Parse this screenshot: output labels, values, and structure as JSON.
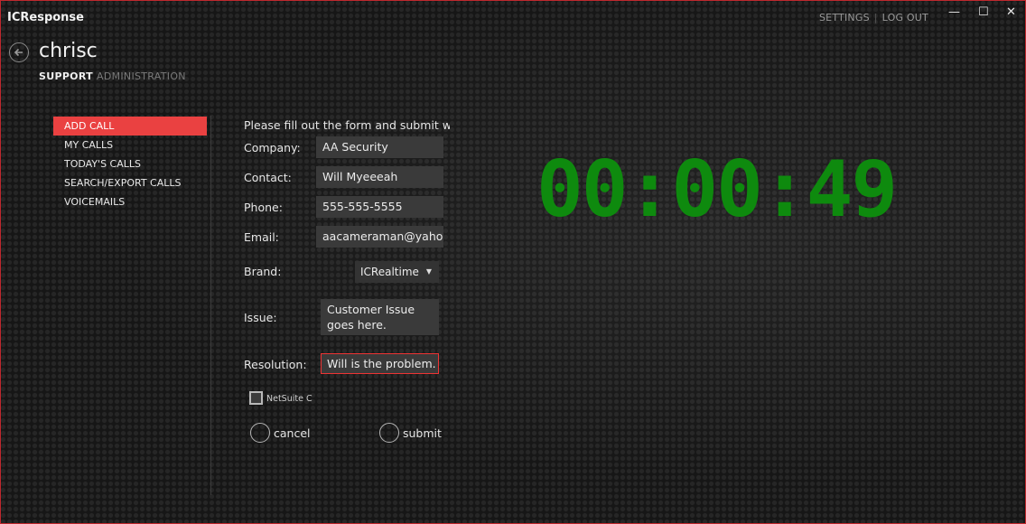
{
  "app": {
    "title": "ICResponse",
    "settings_label": "SETTINGS",
    "logout_label": "LOG OUT",
    "minimize": "—",
    "maximize": "☐",
    "close": "✕",
    "username": "chrisc"
  },
  "nav_tabs": [
    {
      "label": "SUPPORT",
      "active": true
    },
    {
      "label": "ADMINISTRATION",
      "active": false
    }
  ],
  "sidebar": {
    "items": [
      {
        "label": "ADD CALL",
        "active": true
      },
      {
        "label": "MY CALLS"
      },
      {
        "label": "TODAY'S CALLS"
      },
      {
        "label": "SEARCH/EXPORT CALLS"
      },
      {
        "label": "VOICEMAILS"
      }
    ]
  },
  "form": {
    "instructions": "Please fill out the form and submit whe",
    "company_label": "Company:",
    "company_value": "AA Security",
    "contact_label": "Contact:",
    "contact_value": "Will Myeeeah",
    "phone_label": "Phone:",
    "phone_value": "555-555-5555",
    "email_label": "Email:",
    "email_value": "aacameraman@yahoo",
    "brand_label": "Brand:",
    "brand_value": "ICRealtime",
    "issue_label": "Issue:",
    "issue_line1": "Customer Issue",
    "issue_line2": "goes here.",
    "resolution_label": "Resolution:",
    "resolution_value": "Will is the problem.",
    "netsuite_label": "NetSuite C",
    "cancel_label": "cancel",
    "submit_label": "submit"
  },
  "timer": {
    "value": "00:00:49",
    "color": "#0e8a0e"
  },
  "colors": {
    "accent": "#ea4141",
    "border": "#c0282e"
  }
}
